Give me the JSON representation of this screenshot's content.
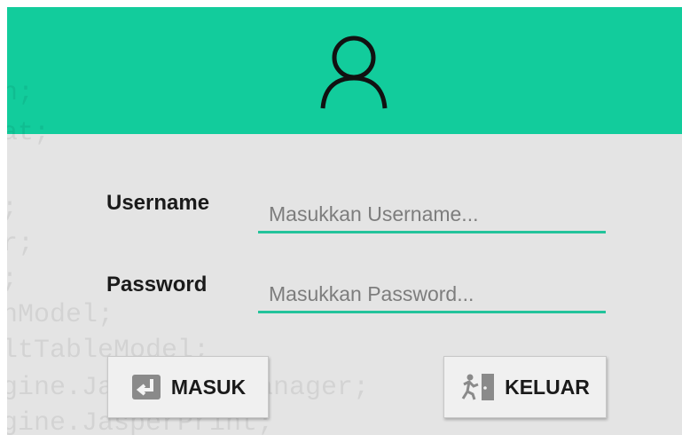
{
  "header": {
    "icon": "user-icon"
  },
  "background_code": [
    "n;",
    "at;",
    ";",
    "r;",
    ";",
    "nModel;",
    "ltTableModel;",
    "gine.JasperViewManager;",
    "gine.JasperPrint;"
  ],
  "form": {
    "username_label": "Username",
    "username_placeholder": "Masukkan Username...",
    "username_value": "",
    "password_label": "Password",
    "password_placeholder": "Masukkan Password...",
    "password_value": ""
  },
  "buttons": {
    "masuk": {
      "label": "MASUK",
      "icon": "login-arrow-icon"
    },
    "keluar": {
      "label": "KELUAR",
      "icon": "exit-door-icon"
    }
  },
  "colors": {
    "accent": "#12cc9c",
    "underline": "#23c39b",
    "panel": "#e4e4e4"
  }
}
